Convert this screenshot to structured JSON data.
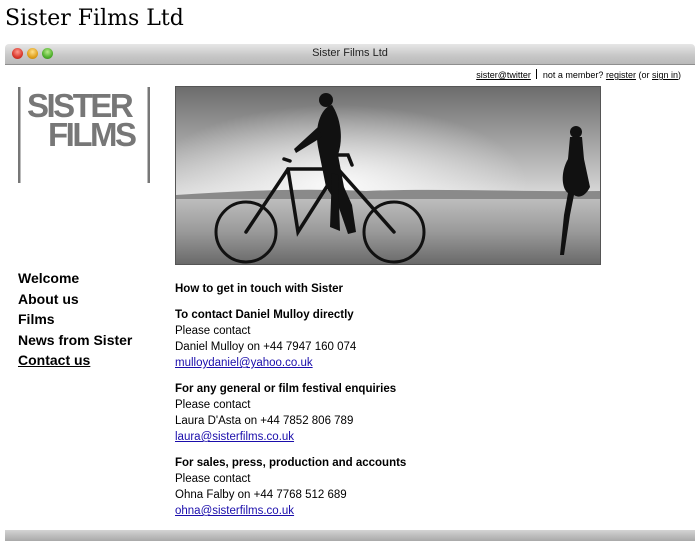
{
  "page": {
    "heading": "Sister Films Ltd"
  },
  "window": {
    "title": "Sister Films Ltd"
  },
  "topbar": {
    "twitter_link": "sister@twitter",
    "not_member": "not a member?",
    "register_link": "register",
    "or_text": "(or",
    "signin_link": "sign in",
    "close_paren": ")"
  },
  "logo": {
    "line1": "SISTER",
    "line2": "FILMS"
  },
  "nav": {
    "items": [
      {
        "label": "Welcome"
      },
      {
        "label": "About us"
      },
      {
        "label": "Films"
      },
      {
        "label": "News from Sister"
      },
      {
        "label": "Contact us",
        "active": true
      }
    ]
  },
  "contact": {
    "heading": "How to get in touch with Sister",
    "sections": [
      {
        "title": "To contact Daniel Mulloy directly",
        "line1": "Please contact",
        "line2": "Daniel Mulloy on +44 7947 160 074",
        "email": "mulloydaniel@yahoo.co.uk"
      },
      {
        "title": "For any general or film festival enquiries",
        "line1": "Please contact",
        "line2": "Laura D'Asta on +44 7852 806 789",
        "email": "laura@sisterfilms.co.uk"
      },
      {
        "title": "For sales, press, production and accounts",
        "line1": "Please contact",
        "line2": "Ohna Falby on +44 7768 512 689",
        "email": "ohna@sisterfilms.co.uk"
      }
    ]
  },
  "colors": {
    "link": "#1a0dab",
    "logo_gray": "#777777"
  }
}
